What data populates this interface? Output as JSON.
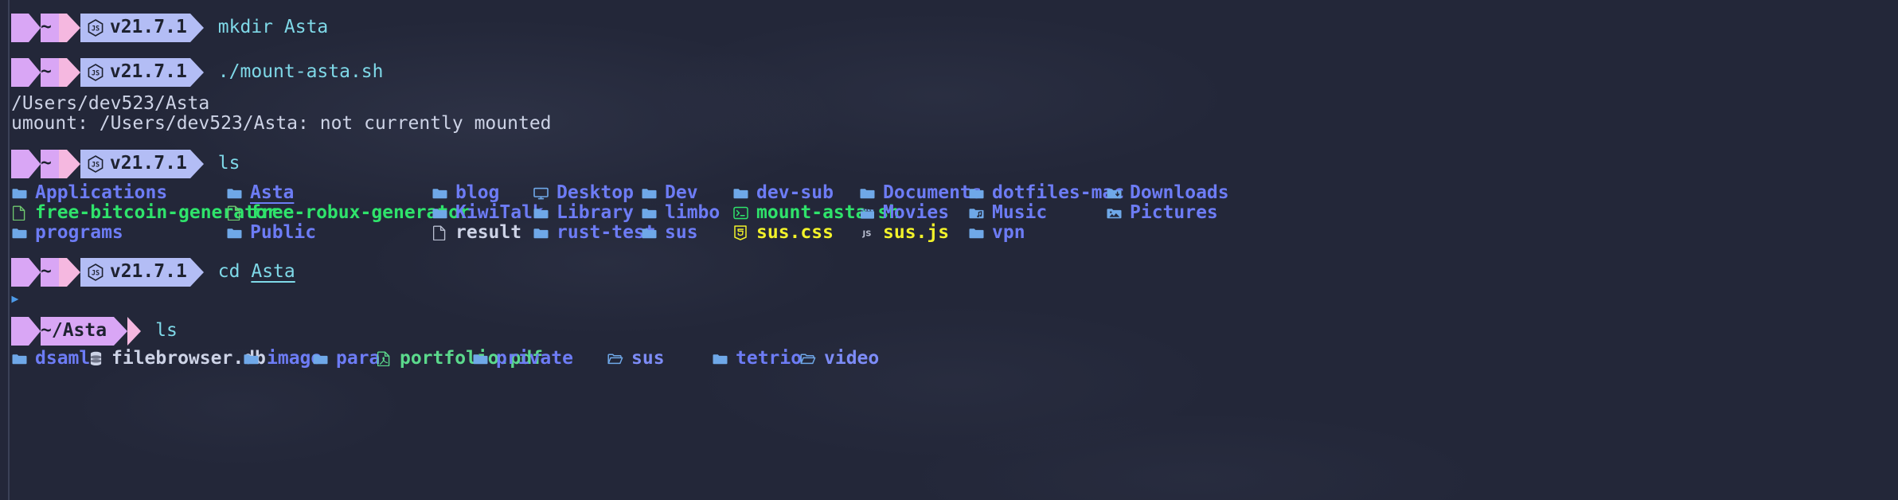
{
  "terminal": {
    "shell_prompt_home_label": "~",
    "runtime_icon": "nodejs-icon",
    "runtime_version": "v21.7.1",
    "colors": {
      "background": "#232739",
      "prompt_segment_1": "#d9a6f5",
      "prompt_separator": "#f5b8e0",
      "prompt_segment_2": "#b3bdf5",
      "command_text": "#7fd9e8",
      "directory": "#6d7cf5",
      "executable": "#2fe36b",
      "executable_yellow": "#f2f22a",
      "plain_text": "#cdd3e6",
      "folder_icon": "#6fa8e8"
    },
    "blocks": [
      {
        "kind": "prompt",
        "path": "~",
        "version": "v21.7.1",
        "command": "mkdir Asta",
        "command_parts": [
          {
            "text": "mkdir ",
            "color": "c-cyan"
          },
          {
            "text": "Asta",
            "color": "c-cyan"
          }
        ]
      },
      {
        "kind": "prompt",
        "path": "~",
        "version": "v21.7.1",
        "command": "./mount-asta.sh"
      },
      {
        "kind": "output",
        "text": "/Users/dev523/Asta"
      },
      {
        "kind": "output",
        "text": "umount: /Users/dev523/Asta: not currently mounted"
      },
      {
        "kind": "prompt",
        "path": "~",
        "version": "v21.7.1",
        "command": "ls"
      },
      {
        "kind": "prompt",
        "path": "~",
        "version": "v21.7.1",
        "command": "cd Asta",
        "command_underlined_arg": "Asta"
      },
      {
        "kind": "prompt",
        "path": "~/Asta",
        "version": null,
        "command": "ls"
      }
    ],
    "output_lines": {
      "mount_path": "/Users/dev523/Asta",
      "umount_message": "umount: /Users/dev523/Asta: not currently mounted"
    },
    "commands": {
      "mkdir": "mkdir Asta",
      "mount_script": "./mount-asta.sh",
      "ls": "ls",
      "cd_asta_prefix": "cd ",
      "cd_asta_arg": "Asta"
    },
    "continuation_marker": "▸"
  },
  "listing_home": {
    "columns": [
      280,
      253,
      122,
      120,
      98,
      219,
      136,
      137,
      202,
      1
    ],
    "rows": [
      [
        {
          "name": "Applications",
          "icon": "folder-icon",
          "color": "c-blue",
          "icon_color": "c-folder",
          "underlined": false
        },
        {
          "name": "Asta",
          "icon": "folder-icon",
          "color": "c-blue",
          "icon_color": "c-folder",
          "underlined": true
        },
        {
          "name": "blog",
          "icon": "folder-icon",
          "color": "c-blue",
          "icon_color": "c-folder",
          "underlined": false
        },
        {
          "name": "Desktop",
          "icon": "desktop-folder-icon",
          "color": "c-blue",
          "icon_color": "c-folder",
          "underlined": false
        },
        {
          "name": "Dev",
          "icon": "folder-icon",
          "color": "c-blue",
          "icon_color": "c-folder",
          "underlined": false
        },
        {
          "name": "dev-sub",
          "icon": "folder-icon",
          "color": "c-blue",
          "icon_color": "c-folder",
          "underlined": false
        },
        {
          "name": "Documents",
          "icon": "folder-icon",
          "color": "c-blue",
          "icon_color": "c-folder",
          "underlined": false
        },
        {
          "name": "dotfiles-mac",
          "icon": "folder-icon",
          "color": "c-blue",
          "icon_color": "c-folder",
          "underlined": false
        },
        {
          "name": "Downloads",
          "icon": "downloads-folder-icon",
          "color": "c-blue",
          "icon_color": "c-folder",
          "underlined": false
        }
      ],
      [
        {
          "name": "free-bitcoin-generator",
          "icon": "file-icon",
          "color": "c-green",
          "icon_color": "c-greenf",
          "underlined": false
        },
        {
          "name": "free-robux-generator",
          "icon": "file-icon",
          "color": "c-green",
          "icon_color": "c-greenf",
          "underlined": false
        },
        {
          "name": "KiwiTalk",
          "icon": "folder-icon",
          "color": "c-blue",
          "icon_color": "c-folder",
          "underlined": false
        },
        {
          "name": "Library",
          "icon": "folder-icon",
          "color": "c-blue",
          "icon_color": "c-folder",
          "underlined": false
        },
        {
          "name": "limbo",
          "icon": "folder-icon",
          "color": "c-blue",
          "icon_color": "c-folder",
          "underlined": false
        },
        {
          "name": "mount-asta.sh",
          "icon": "shell-script-icon",
          "color": "c-green",
          "icon_color": "c-green",
          "underlined": false
        },
        {
          "name": "Movies",
          "icon": "movies-folder-icon",
          "color": "c-blue",
          "icon_color": "c-folder",
          "underlined": false
        },
        {
          "name": "Music",
          "icon": "music-folder-icon",
          "color": "c-blue",
          "icon_color": "c-folder",
          "underlined": false
        },
        {
          "name": "Pictures",
          "icon": "pictures-folder-icon",
          "color": "c-blue",
          "icon_color": "c-folder",
          "underlined": false
        }
      ],
      [
        {
          "name": "programs",
          "icon": "folder-icon",
          "color": "c-blue",
          "icon_color": "c-folder",
          "underlined": false
        },
        {
          "name": "Public",
          "icon": "folder-icon",
          "color": "c-blue",
          "icon_color": "c-folder",
          "underlined": false
        },
        {
          "name": "result",
          "icon": "file-icon",
          "color": "c-white",
          "icon_color": "c-grey",
          "underlined": false
        },
        {
          "name": "rust-test",
          "icon": "folder-icon",
          "color": "c-blue",
          "icon_color": "c-folder",
          "underlined": false
        },
        {
          "name": "sus",
          "icon": "folder-icon",
          "color": "c-blue",
          "icon_color": "c-folder",
          "underlined": false
        },
        {
          "name": "sus.css",
          "icon": "css-icon",
          "color": "c-yellow",
          "icon_color": "c-yellow",
          "underlined": false
        },
        {
          "name": "sus.js",
          "icon": "js-icon",
          "color": "c-yellow",
          "icon_color": "c-grey",
          "underlined": false
        },
        {
          "name": "vpn",
          "icon": "folder-icon",
          "color": "c-blue",
          "icon_color": "c-folder",
          "underlined": false
        }
      ]
    ]
  },
  "listing_asta": {
    "items": [
      {
        "name": "dsaml",
        "icon": "folder-icon",
        "color": "c-blue",
        "icon_color": "c-folder"
      },
      {
        "name": "filebrowser.db",
        "icon": "database-icon",
        "color": "c-white",
        "icon_color": "c-white"
      },
      {
        "name": "image",
        "icon": "folder-icon",
        "color": "c-blue",
        "icon_color": "c-folder"
      },
      {
        "name": "para",
        "icon": "folder-icon",
        "color": "c-blue",
        "icon_color": "c-folder"
      },
      {
        "name": "portfolio.pdf",
        "icon": "pdf-icon",
        "color": "c-mint",
        "icon_color": "c-mint"
      },
      {
        "name": "private",
        "icon": "folder-icon",
        "color": "c-blue",
        "icon_color": "c-folder"
      },
      {
        "name": "sus",
        "icon": "symlink-folder-icon",
        "color": "c-blue2",
        "icon_color": "c-folder"
      },
      {
        "name": "tetrio",
        "icon": "folder-icon",
        "color": "c-blue",
        "icon_color": "c-folder"
      },
      {
        "name": "video",
        "icon": "symlink-folder-icon",
        "color": "c-blue2",
        "icon_color": "c-folder"
      }
    ]
  }
}
